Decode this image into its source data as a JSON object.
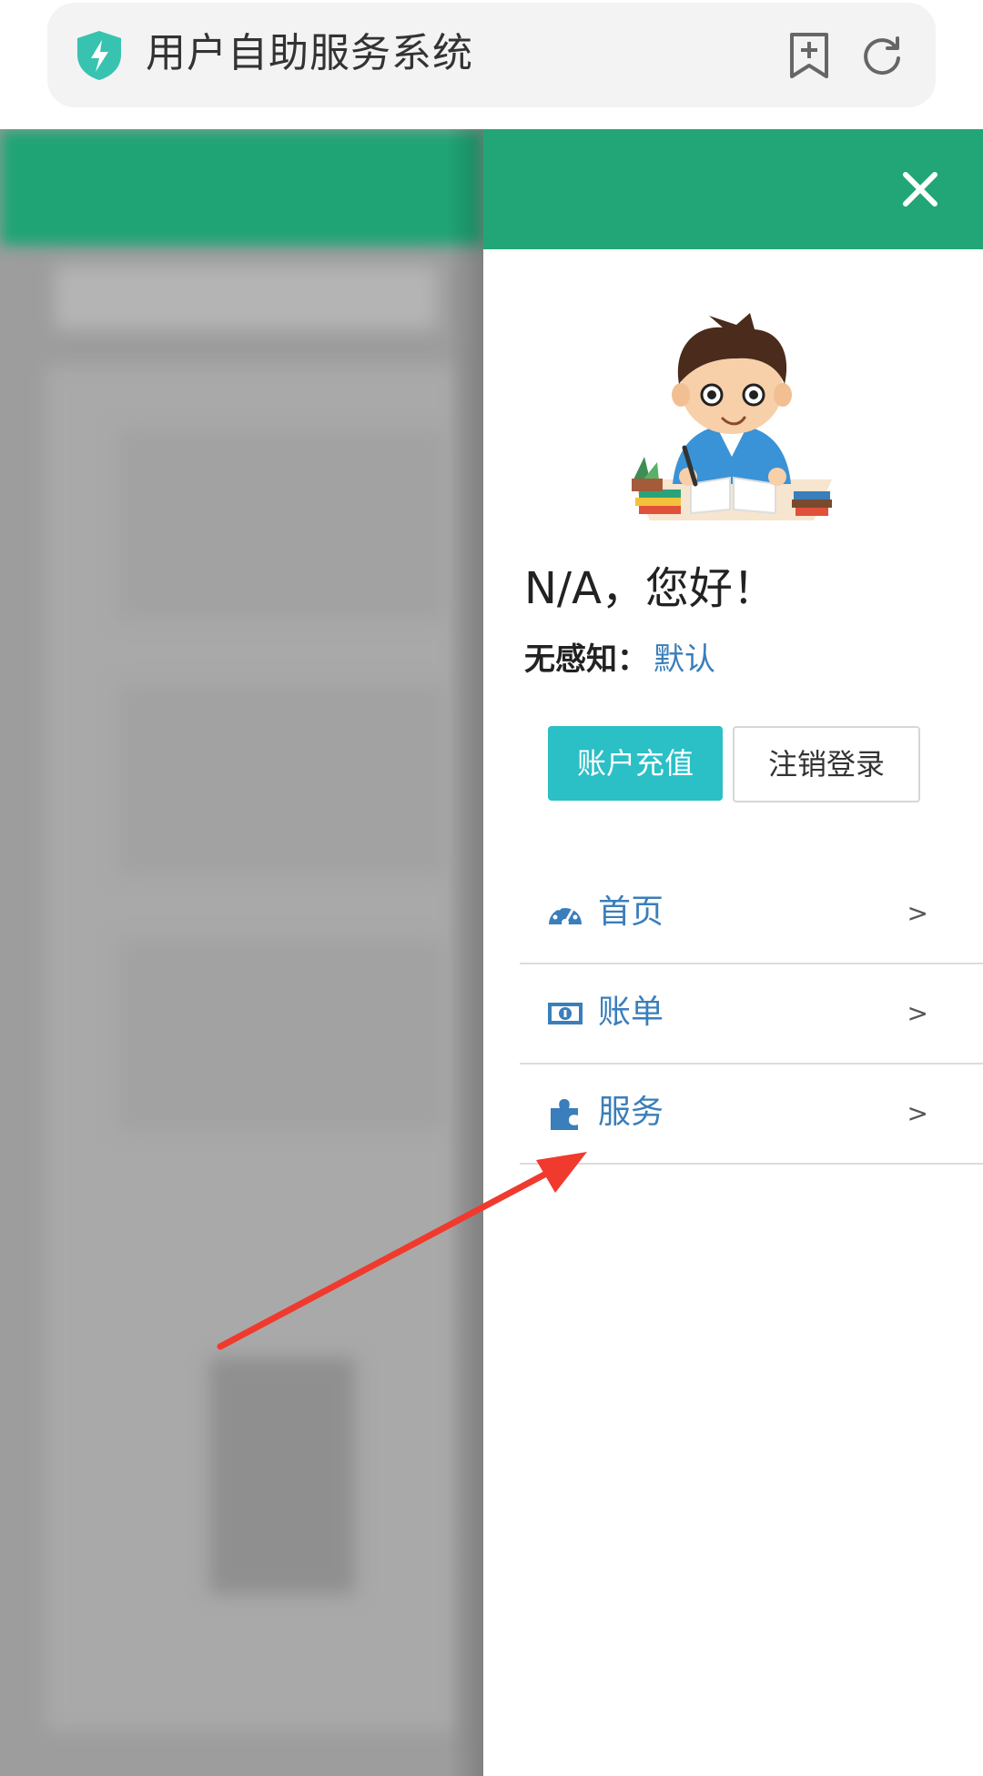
{
  "browser": {
    "title": "用户自助服务系统",
    "icons": {
      "shield": "shield-bolt-icon",
      "bookmark": "bookmark-add-icon",
      "refresh": "refresh-icon"
    }
  },
  "drawer": {
    "header_color": "#22a677",
    "close_icon": "close-icon",
    "greeting": "N/A，您好！",
    "sense_label": "无感知：",
    "sense_value": "默认",
    "recharge_button": "账户充值",
    "logout_button": "注销登录",
    "menu": [
      {
        "label": "首页",
        "icon": "dashboard-icon",
        "arrow": ">"
      },
      {
        "label": "账单",
        "icon": "money-bill-icon",
        "arrow": ">"
      },
      {
        "label": "服务",
        "icon": "puzzle-icon",
        "arrow": ">"
      }
    ]
  },
  "colors": {
    "accent": "#22a677",
    "link": "#3a7ebb",
    "button": "#2bbfc6",
    "annotation": "#f03a2e"
  }
}
